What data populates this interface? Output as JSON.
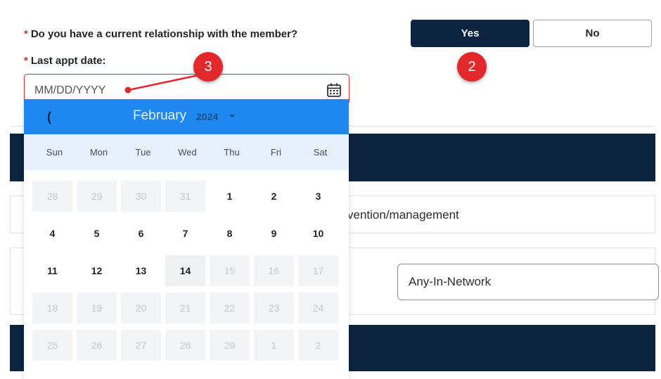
{
  "form": {
    "relationship_question": "Do you have a current relationship with the member?",
    "required_marker": "*",
    "yes_label": "Yes",
    "no_label": "No",
    "last_appt_label": "Last appt date:",
    "date_placeholder": "MM/DD/YYYY",
    "row_text": "vention/management",
    "network_value": "Any-In-Network"
  },
  "calendar": {
    "prev_label": "(",
    "month": "February",
    "year": "2024",
    "weekdays": [
      "Sun",
      "Mon",
      "Tue",
      "Wed",
      "Thu",
      "Fri",
      "Sat"
    ],
    "weeks": [
      [
        {
          "d": "28",
          "s": "off"
        },
        {
          "d": "29",
          "s": "off"
        },
        {
          "d": "30",
          "s": "off"
        },
        {
          "d": "31",
          "s": "off"
        },
        {
          "d": "1",
          "s": "on"
        },
        {
          "d": "2",
          "s": "on"
        },
        {
          "d": "3",
          "s": "on"
        }
      ],
      [
        {
          "d": "4",
          "s": "on"
        },
        {
          "d": "5",
          "s": "on"
        },
        {
          "d": "6",
          "s": "on"
        },
        {
          "d": "7",
          "s": "on"
        },
        {
          "d": "8",
          "s": "on"
        },
        {
          "d": "9",
          "s": "on"
        },
        {
          "d": "10",
          "s": "on"
        }
      ],
      [
        {
          "d": "11",
          "s": "on"
        },
        {
          "d": "12",
          "s": "on"
        },
        {
          "d": "13",
          "s": "on"
        },
        {
          "d": "14",
          "s": "today"
        },
        {
          "d": "15",
          "s": "off"
        },
        {
          "d": "16",
          "s": "off"
        },
        {
          "d": "17",
          "s": "off"
        }
      ],
      [
        {
          "d": "18",
          "s": "off"
        },
        {
          "d": "19",
          "s": "off"
        },
        {
          "d": "20",
          "s": "off"
        },
        {
          "d": "21",
          "s": "off"
        },
        {
          "d": "22",
          "s": "off"
        },
        {
          "d": "23",
          "s": "off"
        },
        {
          "d": "24",
          "s": "off"
        }
      ],
      [
        {
          "d": "25",
          "s": "off"
        },
        {
          "d": "26",
          "s": "off"
        },
        {
          "d": "27",
          "s": "off"
        },
        {
          "d": "28",
          "s": "off"
        },
        {
          "d": "29",
          "s": "off"
        },
        {
          "d": "1",
          "s": "off"
        },
        {
          "d": "2",
          "s": "off"
        }
      ]
    ]
  },
  "annotations": {
    "step2": "2",
    "step3": "3"
  },
  "colors": {
    "navy": "#0d2440",
    "calendar_header": "#1e88f0",
    "required_red": "#d6312b",
    "badge_red": "#e3282b"
  }
}
